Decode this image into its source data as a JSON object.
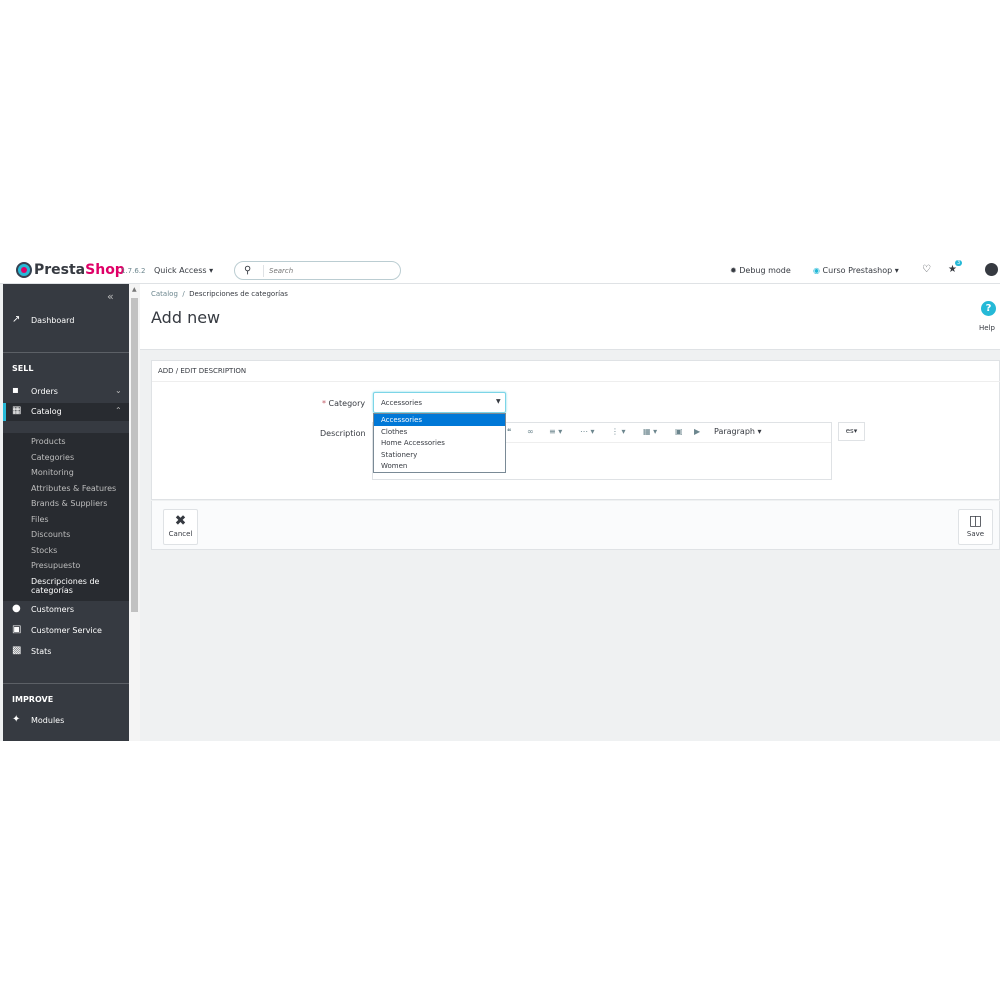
{
  "header": {
    "brand_presta": "Presta",
    "brand_shop": "Shop",
    "version": "1.7.6.2",
    "quick_access": "Quick Access ▾",
    "search_placeholder": "Search",
    "debug": "Debug mode",
    "shop_name": "Curso Prestashop",
    "notifications_badge": "3"
  },
  "sidebar": {
    "dashboard": "Dashboard",
    "section_sell": "SELL",
    "orders": "Orders",
    "catalog": "Catalog",
    "catalog_items": [
      "Products",
      "Categories",
      "Monitoring",
      "Attributes & Features",
      "Brands & Suppliers",
      "Files",
      "Discounts",
      "Stocks",
      "Presupuesto"
    ],
    "current_item_line1": "Descripciones de",
    "current_item_line2": "categorías",
    "customers": "Customers",
    "customer_service": "Customer Service",
    "stats": "Stats",
    "section_improve": "IMPROVE",
    "modules": "Modules"
  },
  "page": {
    "breadcrumb_parent": "Catalog",
    "breadcrumb_current": "Descripciones de categorías",
    "title": "Add new",
    "help": "Help"
  },
  "form": {
    "panel_title": "ADD / EDIT DESCRIPTION",
    "category_required": "*",
    "category_label": "Category",
    "category_value": "Accessories",
    "category_options": [
      "Accessories",
      "Clothes",
      "Home Accessories",
      "Stationery",
      "Women"
    ],
    "description_label": "Description",
    "paragraph": "Paragraph",
    "language": "es",
    "cancel": "Cancel",
    "save": "Save"
  }
}
